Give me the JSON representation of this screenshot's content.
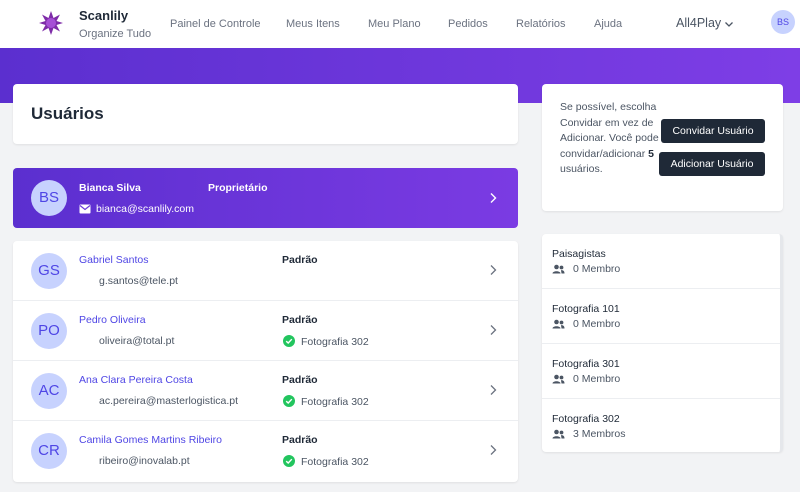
{
  "app": {
    "brand": "Scanlily",
    "tagline": "Organize Tudo"
  },
  "nav": [
    {
      "label": "Painel de Controle",
      "name": "nav-painel"
    },
    {
      "label": "Meus Itens",
      "name": "nav-meus-itens"
    },
    {
      "label": "Meu Plano",
      "name": "nav-meu-plano"
    },
    {
      "label": "Pedidos",
      "name": "nav-pedidos"
    },
    {
      "label": "Relatórios",
      "name": "nav-relatorios"
    },
    {
      "label": "Ajuda",
      "name": "nav-ajuda"
    }
  ],
  "workspace": {
    "label": "All4Play"
  },
  "current_user": {
    "initials": "BS"
  },
  "page": {
    "title": "Usuários"
  },
  "owner": {
    "initials": "BS",
    "name": "Bianca Silva",
    "role": "Proprietário",
    "email": "bianca@scanlily.com"
  },
  "users": [
    {
      "initials": "GS",
      "name": "Gabriel Santos",
      "email": "g.santos@tele.pt",
      "role": "Padrão",
      "group": ""
    },
    {
      "initials": "PO",
      "name": "Pedro Oliveira",
      "email": "oliveira@total.pt",
      "role": "Padrão",
      "group": "Fotografia 302"
    },
    {
      "initials": "AC",
      "name": "Ana Clara Pereira Costa",
      "email": "ac.pereira@masterlogistica.pt",
      "role": "Padrão",
      "group": "Fotografia 302"
    },
    {
      "initials": "CR",
      "name": "Camila Gomes Martins Ribeiro",
      "email": "ribeiro@inovalab.pt",
      "role": "Padrão",
      "group": "Fotografia 302"
    }
  ],
  "invite": {
    "text_before": "Se possível, escolha Convidar em vez de Adicionar. Você pode convidar/adicionar ",
    "count": "5",
    "text_after": " usuários.",
    "invite_button": "Convidar Usuário",
    "add_button": "Adicionar Usuário"
  },
  "groups": [
    {
      "name": "Paisagistas",
      "members": "0 Membro"
    },
    {
      "name": "Fotografia 101",
      "members": "0 Membro"
    },
    {
      "name": "Fotografia 301",
      "members": "0 Membro"
    },
    {
      "name": "Fotografia 302",
      "members": "3 Membros"
    }
  ],
  "colors": {
    "accent": "#5b2fcf",
    "link": "#4f46e5",
    "avatar_bg": "#c7d2fe",
    "success": "#22c55e",
    "button": "#1f2937"
  }
}
